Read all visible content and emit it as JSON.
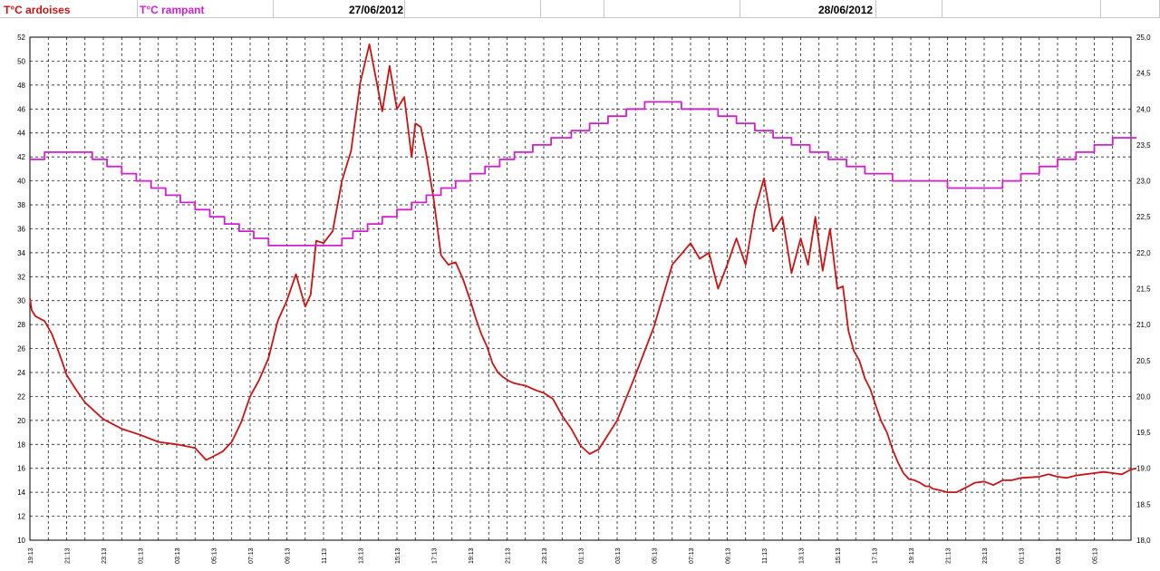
{
  "legend": {
    "series1_label": "T°C ardoises",
    "series2_label": "T°C rampant",
    "series1_color": "#c81414",
    "series2_color": "#d21ed2"
  },
  "dates": {
    "day1": "27/06/2012",
    "day2": "28/06/2012"
  },
  "chart_data": {
    "type": "line",
    "title": "",
    "y_left": {
      "min": 10,
      "max": 52,
      "step": 2
    },
    "y_right": {
      "min": 18.0,
      "max": 25.0,
      "step": 0.5
    },
    "x_tick_labels": [
      "19:13",
      "21:13",
      "23:13",
      "01:13",
      "03:13",
      "05:13",
      "07:13",
      "09:13",
      "11:13",
      "13:13",
      "15:13",
      "17:13",
      "19:13",
      "21:13",
      "23:13",
      "01:13",
      "03:13",
      "05:13",
      "07:13",
      "09:13",
      "11:13",
      "13:13",
      "15:13",
      "17:13",
      "19:13",
      "21:13",
      "23:13",
      "01:13",
      "03:13",
      "05:13"
    ],
    "x_unit": "hours since 19:13 on 26/06/2012",
    "grid": true,
    "series": [
      {
        "name": "T°C ardoises",
        "axis": "left",
        "color": "#c81414",
        "x": [
          0,
          0.1,
          0.3,
          0.8,
          1.2,
          1.6,
          2.0,
          2.5,
          3.0,
          3.5,
          4.0,
          5.0,
          6.0,
          7.0,
          8.0,
          9.0,
          9.6,
          10.0,
          10.5,
          11.0,
          11.5,
          12.0,
          12.5,
          13.0,
          13.5,
          14.0,
          14.5,
          15.0,
          15.3,
          15.6,
          16.0,
          16.5,
          17.0,
          17.5,
          18.0,
          18.5,
          18.8,
          19.2,
          19.6,
          20.0,
          20.4,
          20.8,
          21.0,
          21.3,
          21.6,
          22.0,
          22.4,
          22.8,
          23.2,
          23.6,
          24.0,
          24.3,
          24.6,
          24.9,
          25.2,
          25.5,
          25.8,
          26.1,
          26.4,
          26.7,
          27.0,
          27.3,
          27.6,
          28.0,
          28.5,
          29.0,
          29.5,
          30.0,
          30.5,
          31.0,
          32.0,
          33.0,
          34.0,
          35.0,
          36.0,
          36.5,
          37.0,
          37.5,
          38.0,
          38.5,
          39.0,
          39.5,
          40.0,
          40.5,
          41.0,
          41.5,
          42.0,
          42.4,
          42.8,
          43.2,
          43.6,
          44.0,
          44.3,
          44.6,
          44.9,
          45.2,
          45.5,
          45.8,
          46.1,
          46.4,
          46.7,
          47.0,
          47.3,
          47.6,
          47.9,
          48.2,
          48.5,
          48.8,
          49.0,
          49.2,
          49.5,
          50.0,
          50.5,
          51.0,
          51.5,
          52.0,
          52.5,
          53.0,
          53.5,
          54.0,
          55.0,
          55.5,
          56.0,
          56.5,
          57.0,
          57.5,
          58.0,
          58.5,
          59.0,
          59.5,
          60.0,
          60.3
        ],
        "values": [
          30.2,
          29.2,
          28.7,
          28.3,
          27.2,
          25.6,
          23.8,
          22.6,
          21.5,
          20.8,
          20.1,
          19.3,
          18.8,
          18.2,
          18.0,
          17.7,
          16.7,
          17.0,
          17.4,
          18.2,
          19.8,
          22.0,
          23.4,
          25.2,
          28.3,
          30.0,
          32.2,
          29.5,
          30.5,
          35.0,
          34.8,
          35.8,
          40.0,
          42.5,
          48.2,
          51.4,
          49.0,
          45.8,
          49.6,
          46.0,
          47.0,
          42.0,
          44.8,
          44.5,
          42.2,
          38.5,
          33.8,
          33.0,
          33.2,
          31.8,
          30.0,
          28.5,
          27.2,
          26.2,
          24.8,
          24.0,
          23.6,
          23.3,
          23.1,
          23.0,
          22.9,
          22.7,
          22.5,
          22.3,
          21.8,
          20.4,
          19.3,
          17.9,
          17.2,
          17.6,
          20.0,
          23.8,
          27.8,
          33.0,
          34.8,
          33.5,
          34.0,
          31.0,
          33.0,
          35.2,
          33.0,
          37.5,
          40.2,
          35.8,
          37.0,
          32.3,
          35.2,
          33.0,
          37.0,
          32.5,
          36.0,
          31.0,
          31.2,
          27.5,
          25.8,
          25.0,
          23.5,
          22.6,
          21.2,
          19.9,
          19.0,
          17.6,
          16.5,
          15.6,
          15.1,
          15.0,
          14.8,
          14.5,
          14.5,
          14.3,
          14.2,
          14.0,
          14.0,
          14.4,
          14.8,
          14.9,
          14.6,
          15.0,
          15.0,
          15.2,
          15.3,
          15.5,
          15.3,
          15.2,
          15.4,
          15.5,
          15.6,
          15.7,
          15.6,
          15.5,
          15.9,
          16.0
        ]
      },
      {
        "name": "T°C rampant",
        "axis": "right",
        "color": "#d21ed2",
        "x": [
          0,
          0.3,
          0.8,
          1.5,
          2.5,
          3.2,
          3.4,
          4.2,
          5.0,
          5.8,
          6.6,
          7.4,
          8.2,
          9.0,
          9.8,
          10.6,
          11.4,
          12.2,
          13.0,
          14.0,
          15.0,
          16.0,
          17.0,
          17.6,
          18.4,
          19.2,
          20.0,
          20.8,
          21.6,
          22.4,
          23.2,
          24.0,
          24.8,
          25.6,
          26.4,
          27.4,
          28.4,
          29.5,
          30.5,
          31.5,
          32.5,
          33.5,
          34.5,
          35.5,
          36.5,
          37.5,
          38.5,
          39.5,
          40.5,
          41.5,
          42.5,
          43.5,
          44.5,
          45.5,
          47.0,
          48.5,
          50.0,
          51.0,
          52.0,
          53.0,
          54.0,
          55.0,
          56.0,
          57.0,
          58.0,
          59.0,
          60.0,
          60.3
        ],
        "values": [
          23.3,
          23.3,
          23.4,
          23.4,
          23.4,
          23.4,
          23.3,
          23.2,
          23.1,
          23.0,
          22.9,
          22.8,
          22.7,
          22.6,
          22.5,
          22.4,
          22.3,
          22.2,
          22.1,
          22.1,
          22.1,
          22.1,
          22.2,
          22.3,
          22.4,
          22.5,
          22.6,
          22.7,
          22.8,
          22.9,
          23.0,
          23.1,
          23.2,
          23.3,
          23.4,
          23.5,
          23.6,
          23.7,
          23.8,
          23.9,
          24.0,
          24.1,
          24.1,
          24.0,
          24.0,
          23.9,
          23.8,
          23.7,
          23.6,
          23.5,
          23.4,
          23.3,
          23.2,
          23.1,
          23.0,
          23.0,
          22.9,
          22.9,
          22.9,
          23.0,
          23.1,
          23.2,
          23.3,
          23.4,
          23.5,
          23.6,
          23.6,
          23.6
        ]
      }
    ]
  }
}
